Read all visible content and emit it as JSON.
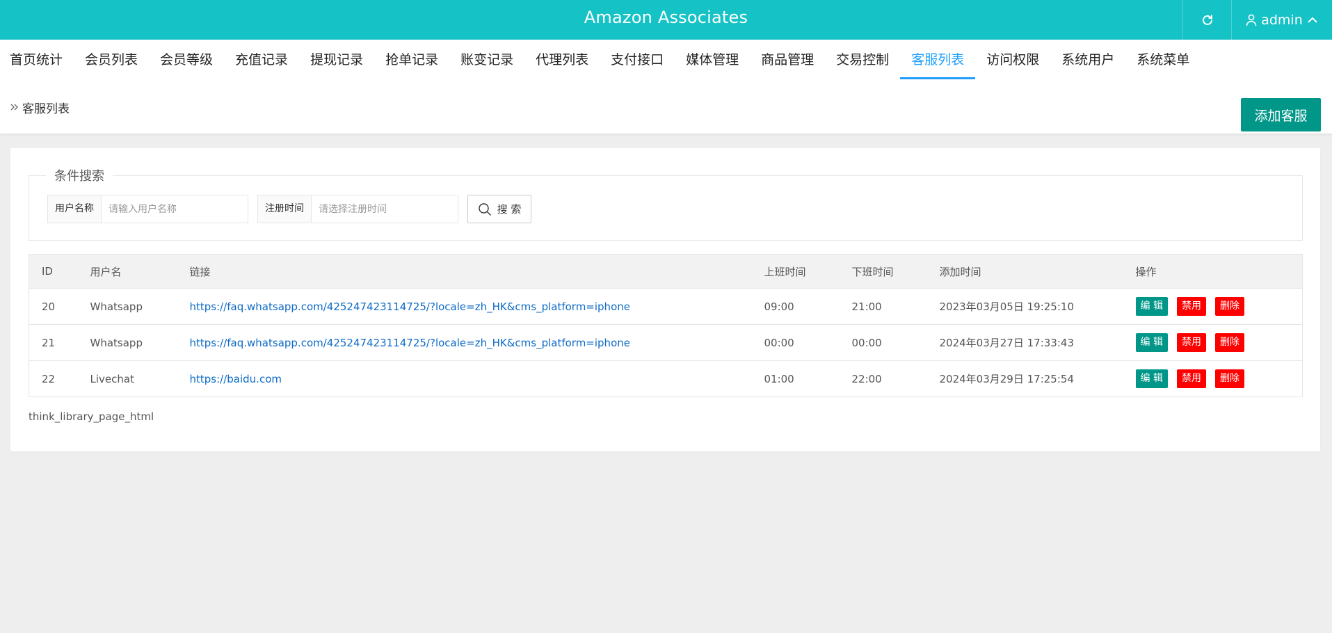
{
  "header": {
    "title": "Amazon Associates",
    "user": "admin"
  },
  "nav": {
    "items": [
      "首页统计",
      "会员列表",
      "会员等级",
      "充值记录",
      "提现记录",
      "抢单记录",
      "账变记录",
      "代理列表",
      "支付接口",
      "媒体管理",
      "商品管理",
      "交易控制",
      "客服列表",
      "访问权限",
      "系统用户",
      "系统菜单"
    ],
    "active": "客服列表"
  },
  "breadcrumb": {
    "current": "客服列表"
  },
  "toolbar": {
    "add_label": "添加客服"
  },
  "search": {
    "legend": "条件搜索",
    "username_label": "用户名称",
    "username_placeholder": "请输入用户名称",
    "regtime_label": "注册时间",
    "regtime_placeholder": "请选择注册时间",
    "button_label": "搜 索"
  },
  "table": {
    "headers": [
      "ID",
      "用户名",
      "链接",
      "上班时间",
      "下班时间",
      "添加时间",
      "操作"
    ],
    "rows": [
      {
        "id": "20",
        "username": "Whatsapp",
        "link": "https://faq.whatsapp.com/425247423114725/?locale=zh_HK&cms_platform=iphone",
        "start": "09:00",
        "end": "21:00",
        "added": "2023年03月05日 19:25:10"
      },
      {
        "id": "21",
        "username": "Whatsapp",
        "link": "https://faq.whatsapp.com/425247423114725/?locale=zh_HK&cms_platform=iphone",
        "start": "00:00",
        "end": "00:00",
        "added": "2024年03月27日 17:33:43"
      },
      {
        "id": "22",
        "username": "Livechat",
        "link": "https://baidu.com",
        "start": "01:00",
        "end": "22:00",
        "added": "2024年03月29日 17:25:54"
      }
    ],
    "actions": {
      "edit": "编 辑",
      "disable": "禁用",
      "delete": "删除"
    }
  },
  "pager": {
    "text": "think_library_page_html"
  },
  "colors": {
    "header_bg": "#15c2c5",
    "active_tab": "#1e9fff",
    "primary_btn": "#009688",
    "danger_btn": "#ff0000",
    "link": "#0e6bc7"
  }
}
